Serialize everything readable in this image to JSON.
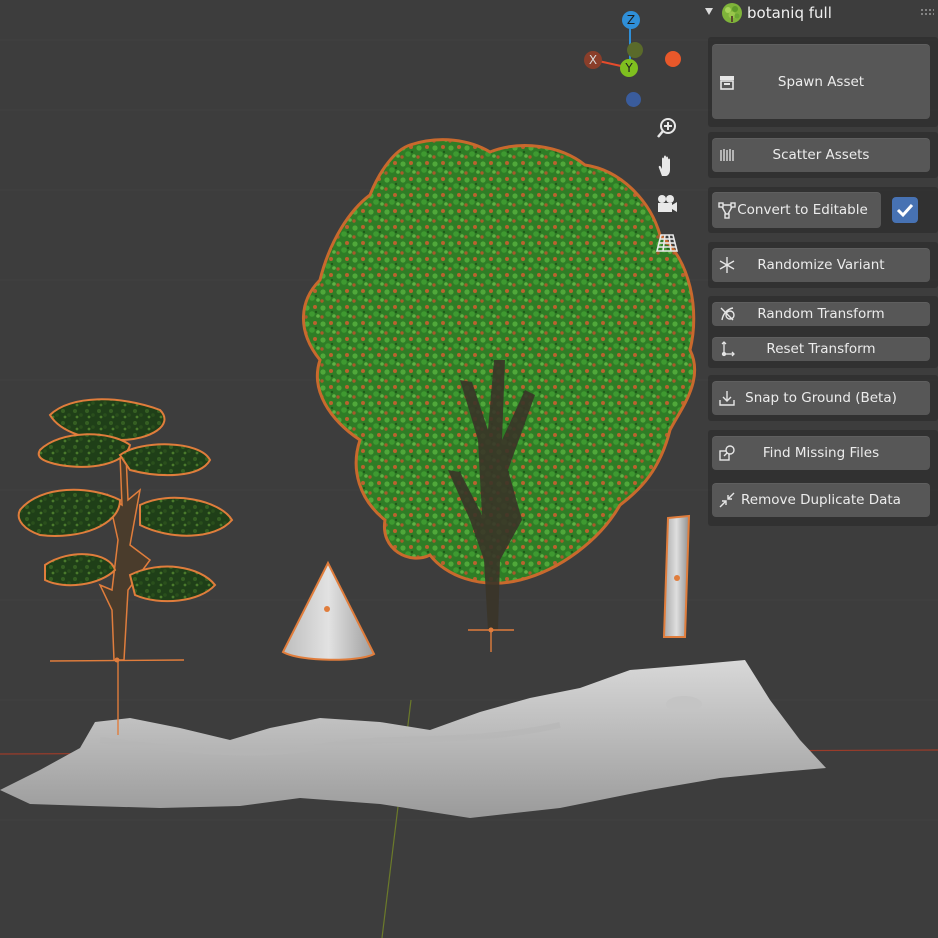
{
  "panel": {
    "title": "botaniq full",
    "buttons": {
      "spawn_asset": "Spawn Asset",
      "scatter_assets": "Scatter Assets",
      "convert_to_editable": "Convert to Editable",
      "randomize_variant": "Randomize Variant",
      "random_transform": "Random Transform",
      "reset_transform": "Reset Transform",
      "snap_to_ground": "Snap to Ground (Beta)",
      "find_missing_files": "Find Missing Files",
      "remove_duplicate_data": "Remove Duplicate Data"
    },
    "convert_checkbox_checked": true
  },
  "gizmo": {
    "z_label": "Z",
    "y_label": "Y",
    "x_label": "X"
  },
  "viewport_tools": [
    "zoom-icon",
    "hand-icon",
    "camera-icon",
    "grid-icon"
  ],
  "colors": {
    "selection_outline": "#e07d3c",
    "foliage": "#3b8f2e",
    "accent": "#4772b3",
    "x_axis": "#e64b2b",
    "y_axis": "#7fbf1f",
    "z_axis": "#2f8fd8"
  }
}
